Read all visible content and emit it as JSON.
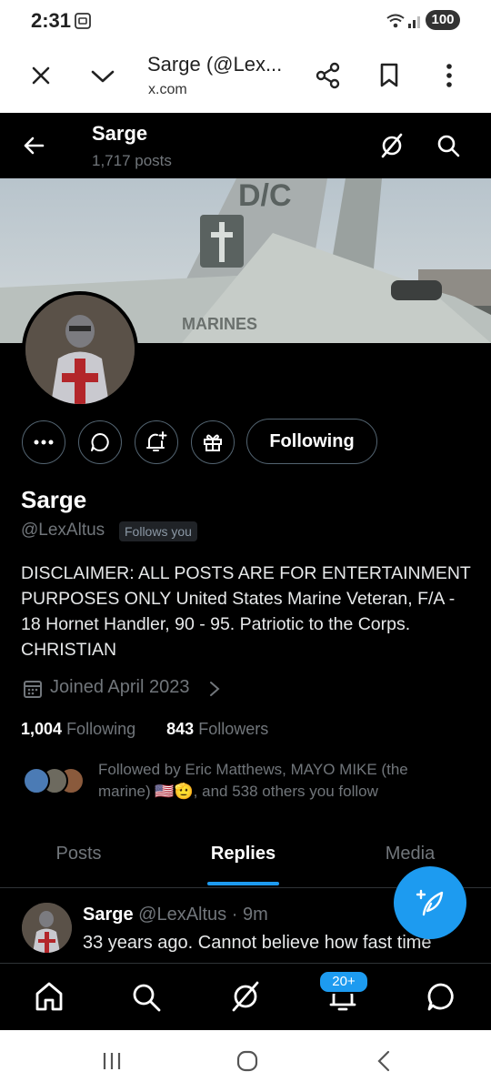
{
  "status": {
    "time": "2:31",
    "battery": "100"
  },
  "browser": {
    "title": "Sarge (@Lex...",
    "domain": "x.com"
  },
  "header": {
    "name": "Sarge",
    "posts": "1,717 posts"
  },
  "banner": {
    "text": "MARINES",
    "tail_code": "D/C"
  },
  "profile": {
    "name": "Sarge",
    "handle": "@LexAltus",
    "follows_you": "Follows you",
    "bio": "DISCLAIMER: ALL POSTS ARE FOR ENTERTAINMENT PURPOSES ONLY United States Marine Veteran, F/A - 18 Hornet Handler, 90 - 95. Patriotic to the Corps. CHRISTIAN",
    "joined": "Joined April 2023",
    "following_count": "1,004",
    "following_label": "Following",
    "followers_count": "843",
    "followers_label": "Followers",
    "followed_by_line1": "Followed by Eric Matthews, MAYO MIKE (the",
    "followed_by_line2": "marine) 🇺🇸🫡, and 538 others you follow"
  },
  "actions": {
    "following_button": "Following"
  },
  "tabs": [
    {
      "label": "Posts",
      "active": false
    },
    {
      "label": "Replies",
      "active": true
    },
    {
      "label": "Media",
      "active": false
    }
  ],
  "post": {
    "name": "Sarge",
    "handle": "@LexAltus",
    "time": "· 9m",
    "text": "33 years ago. Cannot believe how fast time"
  },
  "nav": {
    "notif_badge": "20+"
  },
  "colors": {
    "accent": "#1d9bf0",
    "bg": "#000000",
    "muted": "#71767b"
  }
}
